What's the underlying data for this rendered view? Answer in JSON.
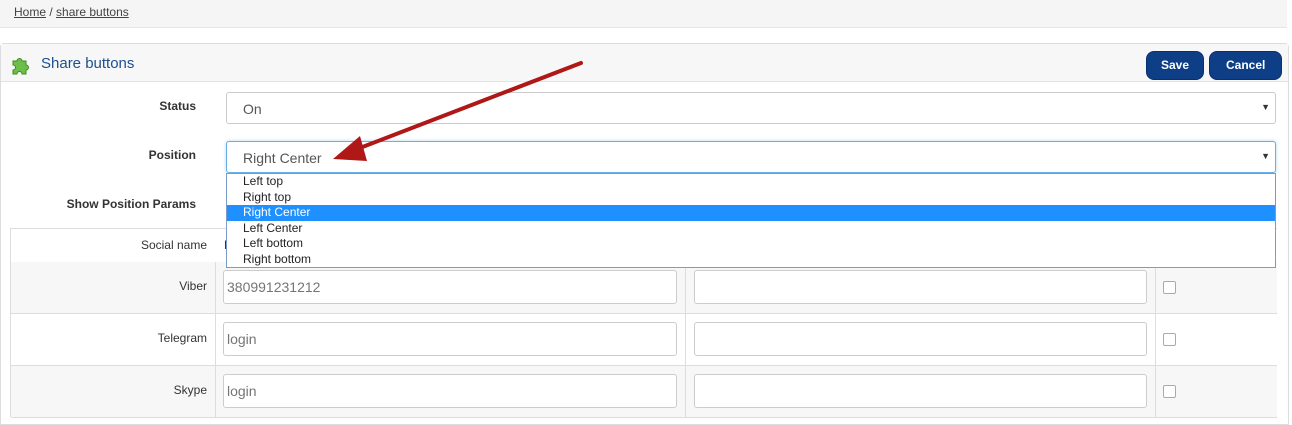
{
  "breadcrumb": {
    "home": "Home",
    "separator": " / ",
    "current": "share buttons"
  },
  "panel": {
    "title": "Share buttons",
    "icon": "puzzle-piece-icon",
    "save_label": "Save",
    "cancel_label": "Cancel"
  },
  "form": {
    "status_label": "Status",
    "status_value": "On",
    "position_label": "Position",
    "position_value": "Right Center",
    "position_options": [
      "Left top",
      "Right top",
      "Right Center",
      "Left Center",
      "Left bottom",
      "Right bottom"
    ],
    "position_highlighted": "Right Center",
    "show_params_label": "Show Position Params"
  },
  "table": {
    "header_social_name": "Social name",
    "header_partial": "H",
    "rows": [
      {
        "name": "Viber",
        "placeholder": "380991231212"
      },
      {
        "name": "Telegram",
        "placeholder": "login"
      },
      {
        "name": "Skype",
        "placeholder": "login"
      }
    ]
  },
  "colors": {
    "button": "#0e3e86",
    "title": "#1d4f8f",
    "highlight": "#1e90ff",
    "arrow": "#b01717"
  }
}
